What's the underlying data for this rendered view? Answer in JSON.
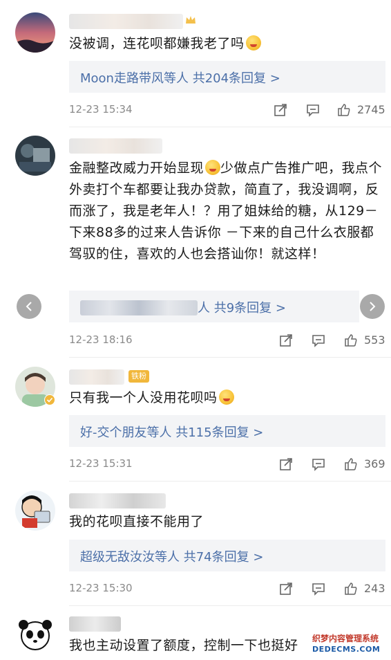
{
  "comments": [
    {
      "text": "没被调，连花呗都嫌我老了吗",
      "reply_prefix": "Moon走路带风",
      "reply_suffix": "等人 共204条回复 >",
      "time": "12-23 15:34",
      "likes": "2745"
    },
    {
      "text": "金融整改威力开始显现",
      "text_rest": "少做点广告推广吧，我点个外卖打个车都要让我办贷款，简直了，我没调啊，反而涨了，我是老年人！？用了姐妹给的糖，从129－下来88多的过来人告诉你 －下来的自己什么衣服都驾驭的住，喜欢的人也会搭讪你！就这样！",
      "reply_suffix": "人 共9条回复 >",
      "time": "12-23 18:16",
      "likes": "553"
    },
    {
      "badge": "铁粉",
      "text": "只有我一个人没用花呗吗",
      "reply_prefix": "好-交个朋友",
      "reply_suffix": "等人 共115条回复 >",
      "time": "12-23 15:31",
      "likes": "369"
    },
    {
      "text": "我的花呗直接不能用了",
      "reply_prefix": "超级无敌汝汝",
      "reply_suffix": "等人 共74条回复 >",
      "time": "12-23 15:30",
      "likes": "243"
    },
    {
      "text": "我也主动设置了额度，控制一下也挺好"
    }
  ],
  "watermark": {
    "line1": "织梦内容管理系统",
    "line2": "DEDECMS.COM"
  },
  "icons": [
    "share-icon",
    "comment-icon",
    "like-icon",
    "chevron-left-icon",
    "chevron-right-icon",
    "crown-icon"
  ],
  "colors": {
    "link": "#4b6fa8",
    "meta": "#8a8a8a",
    "reply_bg": "#f3f4f6",
    "badge": "#f1b73b"
  }
}
